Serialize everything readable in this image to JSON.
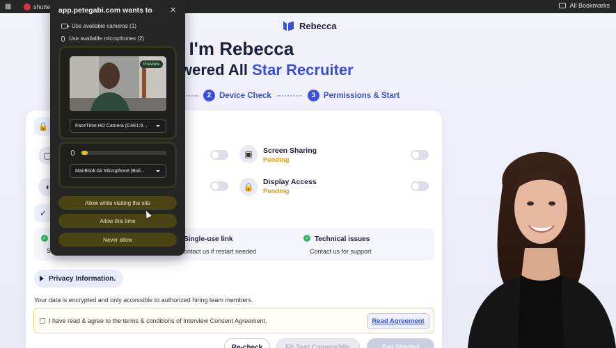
{
  "browser": {
    "tab_title": "shutter",
    "bookmarks_label": "All Bookmarks"
  },
  "app": {
    "brand": "Rebecca",
    "heading": ", I'm Rebecca",
    "subheading_prefix": "wered All ",
    "subheading_accent": "Star Recruiter",
    "steps": [
      {
        "num": "2",
        "label": "Device Check"
      },
      {
        "num": "3",
        "label": "Permissions & Start"
      }
    ]
  },
  "permissions": [
    {
      "title": "Screen Sharing",
      "status": "Pending"
    },
    {
      "title": "Display Access",
      "status": "Pending"
    }
  ],
  "info": [
    {
      "title": "Single-use link",
      "subtitle": "ontact us if restart needed"
    },
    {
      "title": "Technical issues",
      "subtitle": "Contact us for support"
    }
  ],
  "info_left_subtitle": "S",
  "privacy": {
    "label": "Privacy Information.",
    "encrypted_text": "Your data is encrypted and only accessible to authorized hiring team members.",
    "agree_text": "I have read & agree to the terms & conditions of Interview Consent Agreement.",
    "read_button": "Read Agreement"
  },
  "buttons": {
    "recheck": "Re-check",
    "fix": "Fit Test Camera/Mic",
    "start": "Get Started"
  },
  "popup": {
    "title": "app.petegabi.com wants to",
    "cameras": "Use available cameras (1)",
    "microphones": "Use available microphones (2)",
    "preview_badge": "Preview",
    "camera_select": "FaceTime HD Camera (C4E1:9...",
    "mic_select": "MacBook Air Microphone (Buil...",
    "mic_level": 0.07,
    "allow_visiting": "Allow while visiting the site",
    "allow_once": "Allow this time",
    "never": "Never allow"
  },
  "colors": {
    "accent": "#3b4ee0",
    "pending": "#e39a16",
    "success": "#33b36b",
    "popup_bg": "#262626",
    "popup_button": "#4a4414"
  }
}
